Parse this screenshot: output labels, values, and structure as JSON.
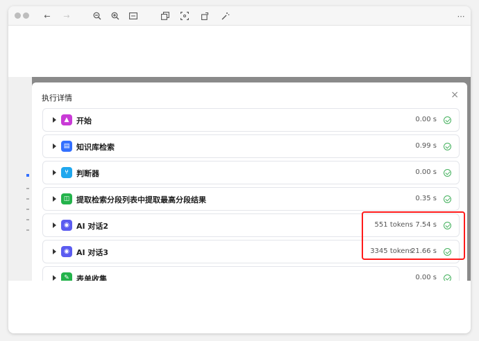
{
  "toolbar": {
    "icons": [
      "close-dot",
      "minimize-dot",
      "back-arrow",
      "forward-arrow",
      "zoom-out",
      "zoom-in",
      "fit-screen",
      "copy",
      "screenshot-area",
      "rotate",
      "magic-wand",
      "more"
    ],
    "back_glyph": "←",
    "forward_glyph": "→",
    "more_glyph": "⋯"
  },
  "modal": {
    "title": "执行详情",
    "close_glyph": "×"
  },
  "nodes": [
    {
      "label": "开始",
      "time": "0.00 s",
      "tokens": "",
      "color": "#c93bd6",
      "glyph": "▲"
    },
    {
      "label": "知识库检索",
      "time": "0.99 s",
      "tokens": "",
      "color": "#3370ff",
      "glyph": "▤"
    },
    {
      "label": "判断器",
      "time": "0.00 s",
      "tokens": "",
      "color": "#1fa7ee",
      "glyph": "⑂"
    },
    {
      "label": "提取检索分段列表中提取最高分段结果",
      "time": "0.35 s",
      "tokens": "",
      "color": "#24b34b",
      "glyph": "◫"
    },
    {
      "label": "AI 对话2",
      "time": "7.54 s",
      "tokens": "551 tokens",
      "color": "#5b5cf0",
      "glyph": "◉"
    },
    {
      "label": "AI 对话3",
      "time": "21.66 s",
      "tokens": "3345 tokens",
      "color": "#5b5cf0",
      "glyph": "◉"
    },
    {
      "label": "表单收集",
      "time": "0.00 s",
      "tokens": "",
      "color": "#24b34b",
      "glyph": "✎"
    }
  ],
  "colors": {
    "highlight": "#ff1a1a",
    "success": "#43b05c"
  }
}
